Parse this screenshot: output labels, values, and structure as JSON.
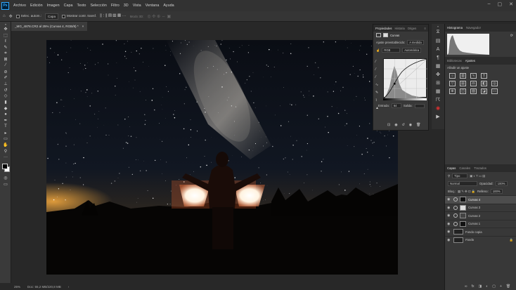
{
  "menubar": {
    "logo": "Ps",
    "items": [
      "Archivo",
      "Edición",
      "Imagen",
      "Capa",
      "Texto",
      "Selección",
      "Filtro",
      "3D",
      "Vista",
      "Ventana",
      "Ayuda"
    ],
    "window_controls": [
      "–",
      "▢",
      "✕"
    ]
  },
  "options_bar": {
    "auto_select": "Selec. autom.:",
    "layer_select": "Capa",
    "show_transform": "Mostrar contr. transf.",
    "mode3d": "Modo 3D:"
  },
  "document": {
    "tab_title": "_MG_4878.CR2 al 25% (Curvas 4, RGB/8) *",
    "close": "×"
  },
  "status": {
    "zoom": "25%",
    "doc_info": "Doc: 55,2 MB/220,8 MB"
  },
  "properties": {
    "tabs": [
      "Propiedades",
      "Historia",
      "Origen"
    ],
    "panel_title": "Curvas",
    "preset_label": "Ajuste preestablecido:",
    "preset_value": "A medida",
    "channel": "RGB",
    "auto_button": "Automática",
    "input_label": "Entrada:",
    "input_value": "64",
    "output_label": "Salida:",
    "output_value": ""
  },
  "histogram_panel": {
    "tabs": [
      "Histograma",
      "Navegador"
    ]
  },
  "adjust_panel": {
    "tabs": [
      "Bibliotecas",
      "Ajustes"
    ],
    "add_label": "Añadir un ajuste"
  },
  "layers_panel": {
    "tabs": [
      "Capas",
      "Canales",
      "Trazados"
    ],
    "filter": "Tipo",
    "blend_mode": "Normal",
    "opacity_label": "Opacidad:",
    "opacity_value": "100%",
    "lock_label": "Bloq.:",
    "fill_label": "Relleno:",
    "fill_value": "100%",
    "layers": [
      {
        "name": "Curvas 4",
        "selected": true
      },
      {
        "name": "Curvas 3",
        "selected": false
      },
      {
        "name": "Curvas 2",
        "selected": false
      },
      {
        "name": "Curvas 1",
        "selected": false
      },
      {
        "name": "Fondo copia",
        "selected": false
      },
      {
        "name": "Fondo",
        "selected": false
      }
    ],
    "footer_icons": [
      "∞",
      "fx",
      "◨",
      "◐",
      "▢",
      "+",
      "🗑"
    ]
  },
  "colors": {
    "accent": "#31a8ff",
    "panel_bg": "#383838",
    "ui_bg": "#282828"
  }
}
